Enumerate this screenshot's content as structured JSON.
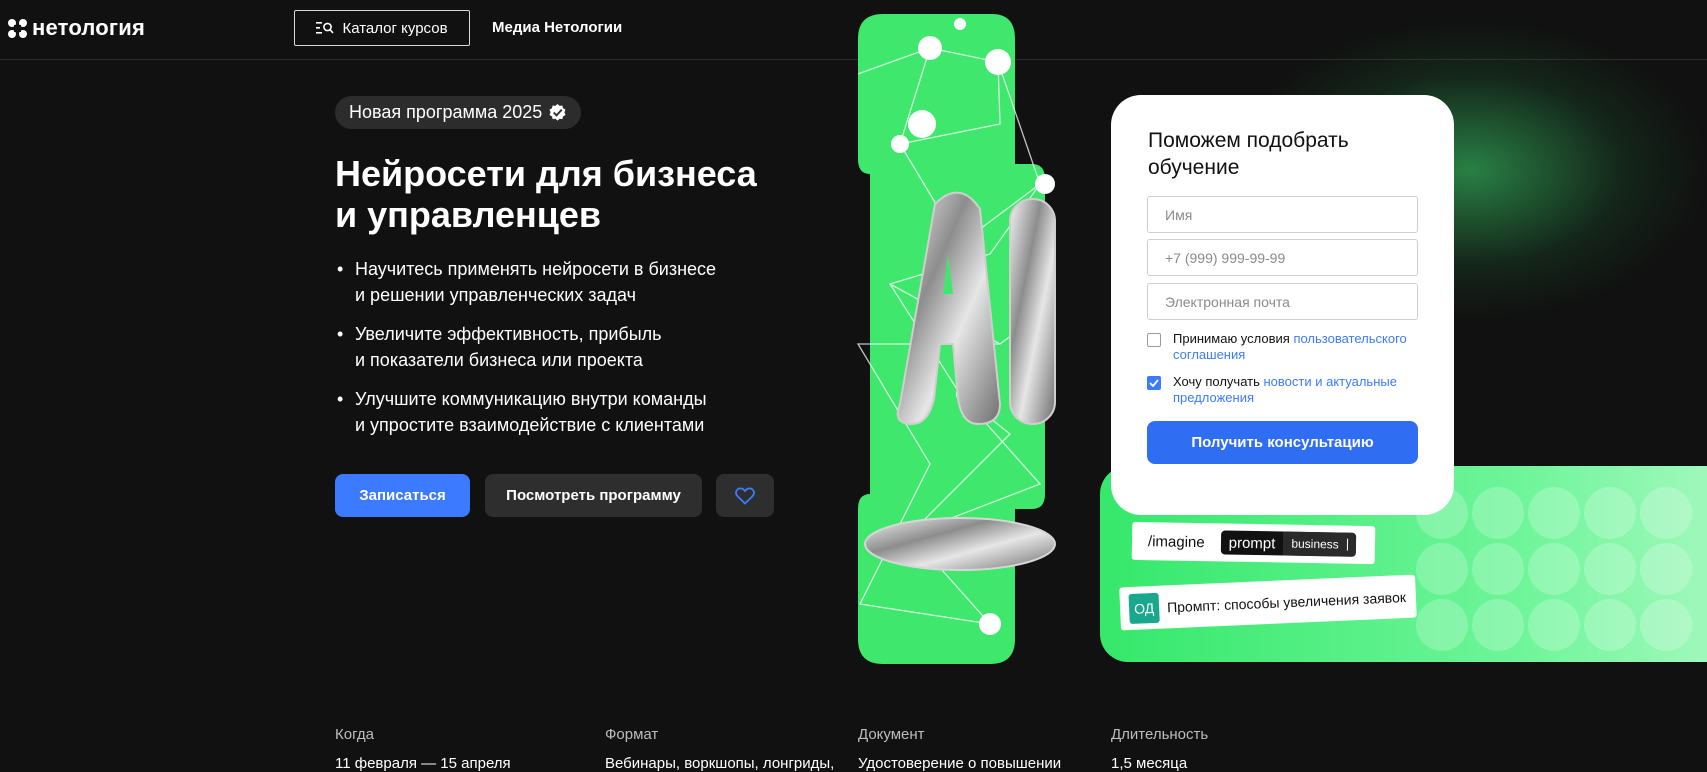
{
  "header": {
    "logo_text": "нетология",
    "catalog_label": "Каталог курсов",
    "media_label": "Медиа Нетологии"
  },
  "hero": {
    "badge": "Новая программа 2025",
    "title_line1": "Нейросети для бизнеса",
    "title_line2": "и управленцев",
    "bullets": [
      {
        "line1": "Научитесь применять нейросети в бизнесе",
        "line2": "и решении управленческих задач"
      },
      {
        "line1": "Увеличите эффективность, прибыль",
        "line2": "и показатели бизнеса или проекта"
      },
      {
        "line1": "Улучшите коммуникацию внутри команды",
        "line2": "и упростите взаимодействие с клиентами"
      }
    ],
    "signup_label": "Записаться",
    "program_label": "Посмотреть программу"
  },
  "art": {
    "ai_letters": "AI",
    "imagine_text": "/imagine",
    "prompt_word": "prompt",
    "business_word": "business",
    "avatar_initials": "ОД",
    "prompt_text": "Промпт: способы увеличения заявок"
  },
  "form": {
    "title": "Поможем подобрать обучение",
    "name_placeholder": "Имя",
    "phone_placeholder": "+7 (999) 999-99-99",
    "email_placeholder": "Электронная почта",
    "terms_text": "Принимаю условия ",
    "terms_link": "пользовательского соглашения",
    "terms_checked": false,
    "news_text": "Хочу получать ",
    "news_link": "новости и актуальные предложения",
    "news_checked": true,
    "submit_label": "Получить консультацию"
  },
  "info": [
    {
      "label": "Когда",
      "value": "11 февраля — 15 апреля"
    },
    {
      "label": "Формат",
      "value": "Вебинары, воркшопы, лонгриды,"
    },
    {
      "label": "Документ",
      "value": "Удостоверение о повышении"
    },
    {
      "label": "Длительность",
      "value": "1,5 месяца"
    }
  ],
  "colors": {
    "background": "#111111",
    "accent_blue": "#3c7bff",
    "accent_green": "#3fe76d"
  },
  "icons": [
    "logo-icon",
    "catalog-search-icon",
    "verified-icon",
    "heart-icon",
    "check-icon"
  ]
}
